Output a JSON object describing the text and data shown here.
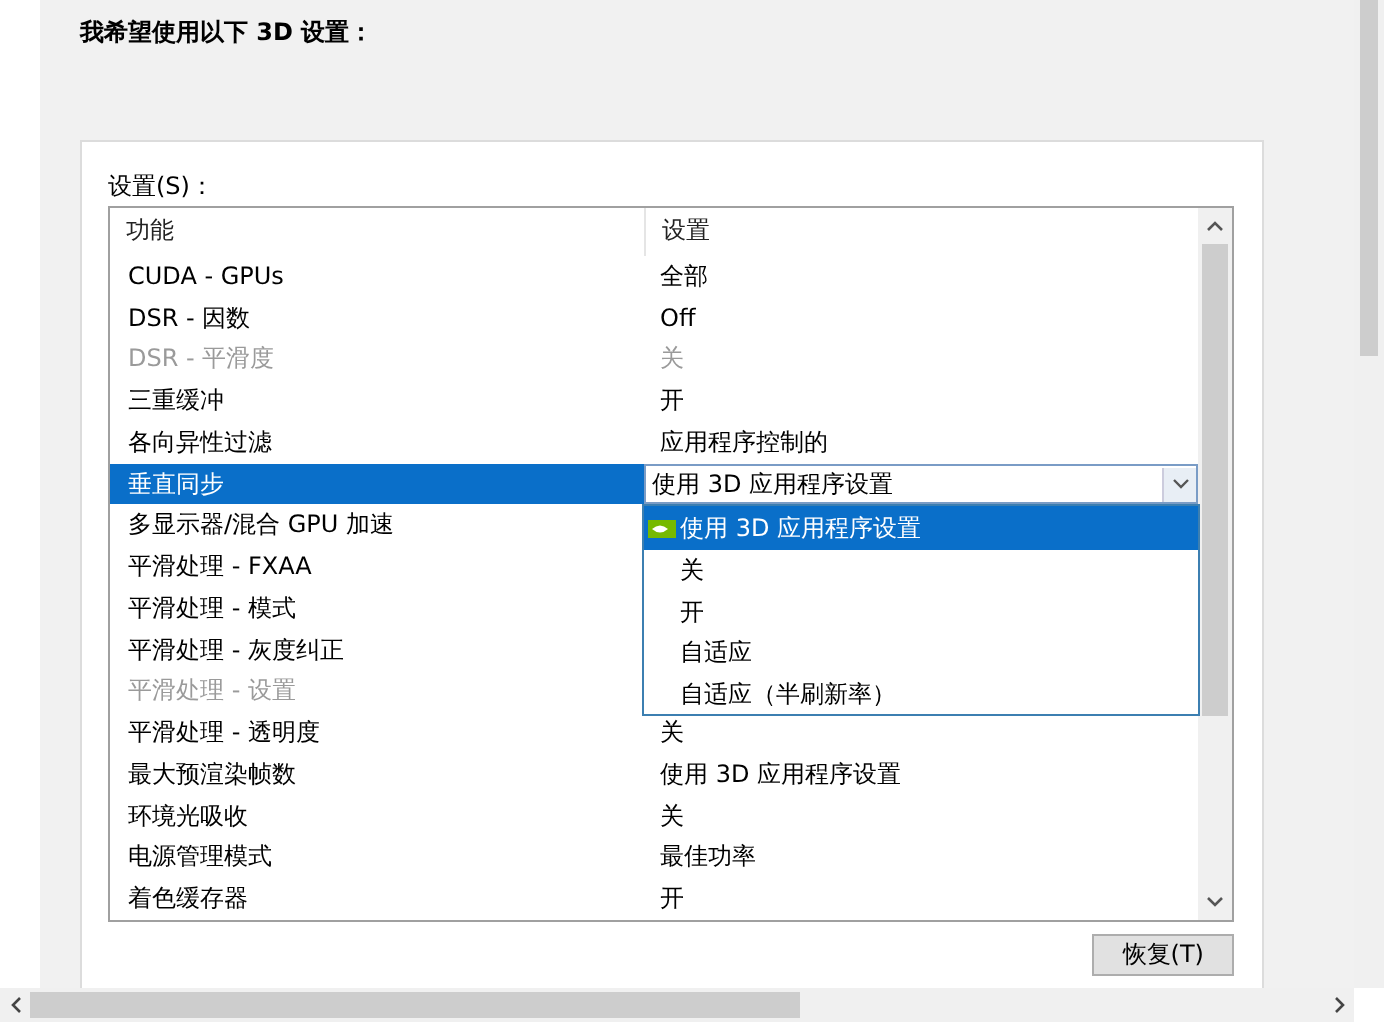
{
  "heading": "我希望使用以下 3D 设置：",
  "settings_label": "设置(S)：",
  "table": {
    "columns": [
      "功能",
      "设置"
    ],
    "rows": [
      {
        "feature": "CUDA - GPUs",
        "setting": "全部",
        "disabled": false,
        "selected": false
      },
      {
        "feature": "DSR - 因数",
        "setting": "Off",
        "disabled": false,
        "selected": false
      },
      {
        "feature": "DSR - 平滑度",
        "setting": "关",
        "disabled": true,
        "selected": false
      },
      {
        "feature": "三重缓冲",
        "setting": "开",
        "disabled": false,
        "selected": false
      },
      {
        "feature": "各向异性过滤",
        "setting": "应用程序控制的",
        "disabled": false,
        "selected": false
      },
      {
        "feature": "垂直同步",
        "disabled": false,
        "selected": true,
        "dropdown": {
          "value": "使用 3D 应用程序设置",
          "expanded": true,
          "options": [
            {
              "label": "使用 3D 应用程序设置",
              "selected": true
            },
            {
              "label": "关",
              "selected": false
            },
            {
              "label": "开",
              "selected": false
            },
            {
              "label": "自适应",
              "selected": false
            },
            {
              "label": "自适应（半刷新率）",
              "selected": false
            }
          ]
        }
      },
      {
        "feature": "多显示器/混合 GPU 加速",
        "disabled": false,
        "selected": false
      },
      {
        "feature": "平滑处理 - FXAA",
        "disabled": false,
        "selected": false
      },
      {
        "feature": "平滑处理 - 模式",
        "disabled": false,
        "selected": false
      },
      {
        "feature": "平滑处理 - 灰度纠正",
        "disabled": false,
        "selected": false
      },
      {
        "feature": "平滑处理 - 设置",
        "disabled": true,
        "selected": false
      },
      {
        "feature": "平滑处理 - 透明度",
        "setting": "关",
        "disabled": false,
        "selected": false
      },
      {
        "feature": "最大预渲染帧数",
        "setting": "使用 3D 应用程序设置",
        "disabled": false,
        "selected": false
      },
      {
        "feature": "环境光吸收",
        "setting": "关",
        "disabled": false,
        "selected": false
      },
      {
        "feature": "电源管理模式",
        "setting": "最佳功率",
        "disabled": false,
        "selected": false
      },
      {
        "feature": "着色缓存器",
        "setting": "开",
        "disabled": false,
        "selected": false
      }
    ]
  },
  "restore_button": "恢复(T)"
}
